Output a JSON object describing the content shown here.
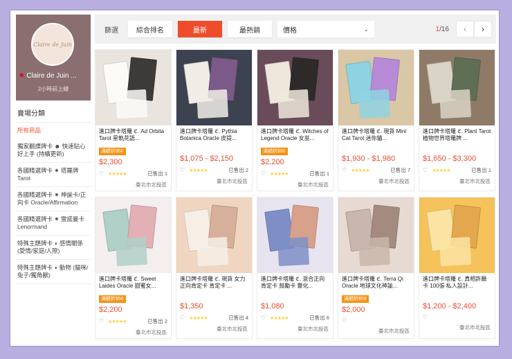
{
  "shop": {
    "logo_text": "Claire de Juin",
    "name": "Claire de Juin ...",
    "status": "2小時前上線"
  },
  "sidebar": {
    "title": "賣場分類",
    "items": [
      {
        "label": "所有商品",
        "active": true
      },
      {
        "label": "獨家翻譯牌卡 ☻ 快速贴心好上手 (持續更新)"
      },
      {
        "label": "各國精選牌卡 ✷ 塔羅牌 Tarot"
      },
      {
        "label": "各國精選牌卡 ✷ 神諭卡/正向卡 Oracle/Affirmation"
      },
      {
        "label": "各國精選牌卡 ✷ 雷諾曼卡 Lenormand"
      },
      {
        "label": "特殊主題牌卡 ◗ 感情關係 (愛情/家庭/人際)"
      },
      {
        "label": "特殊主題牌卡 ◗ 動物 (貓咪/兔子/獨角獸)"
      }
    ]
  },
  "filter": {
    "label": "篩選",
    "buttons": [
      "綜合排名",
      "最新",
      "最熱銷"
    ],
    "active": "最新",
    "price_select": "價格",
    "page_current": "1",
    "page_total": "/16",
    "prev": "‹",
    "next": "›"
  },
  "products": [
    {
      "name": "進口牌卡塔羅 ℭ. Ad Orbita Tarot 星軌花語...",
      "promo": "滿額折$50",
      "price": "$2,300",
      "rating": 5,
      "sold": "已售出 1",
      "location": "臺北市北投區"
    },
    {
      "name": "進口牌卡塔羅 ℭ. Pythia Botanica Oracle 皮提...",
      "promo": "",
      "price": "$1,075 - $2,150",
      "rating": 5,
      "sold": "已售出 2",
      "location": "臺北市北投區"
    },
    {
      "name": "進口牌卡塔羅 ℭ. Witches of Legend Oracle 女巫...",
      "promo": "滿額折$50",
      "price": "$2,200",
      "rating": 5,
      "sold": "已售出 1",
      "location": "臺北市北投區"
    },
    {
      "name": "進口牌卡塔羅 ℭ. 現貨 Mini Cat Tarot 迷你貓...",
      "promo": "",
      "price": "$1,930 - $1,980",
      "rating": 5,
      "sold": "已售出 7",
      "location": "臺北市北投區"
    },
    {
      "name": "進口牌卡塔羅 ℭ. Plant Tarot 植物世界塔羅牌 ...",
      "promo": "",
      "price": "$1,650 - $3,300",
      "rating": 5,
      "sold": "已售出 1",
      "location": "臺北市北投區"
    },
    {
      "name": "進口牌卡塔羅 ℭ. Sweet Laides Oracle 甜蜜女...",
      "promo": "滿額折$50",
      "price": "$2,200",
      "rating": 5,
      "sold": "已售出 2",
      "location": "臺北市北投區"
    },
    {
      "name": "進口牌卡塔羅 ℭ. 現貨 女力正向肯定卡 肯定卡 ...",
      "promo": "",
      "price": "$1,350",
      "rating": 5,
      "sold": "已售出 4",
      "location": "臺北市北投區"
    },
    {
      "name": "進口牌卡塔羅 ℭ. 混合正向肯定卡 鼓勵卡 靈化...",
      "promo": "",
      "price": "$1,080",
      "rating": 5,
      "sold": "已售出 6",
      "location": "臺北市北投區"
    },
    {
      "name": "進口牌卡塔羅 ℭ. Terra Qi Oracle 地球文化神諭...",
      "promo": "滿額折$50",
      "price": "$2,000",
      "rating": 0,
      "sold": "",
      "location": "臺北市北投區"
    },
    {
      "name": "進口牌卡塔羅 ℭ. 真相許願卡 100張 私人設計...",
      "promo": "",
      "price": "$1,200 - $2,400",
      "rating": 0,
      "sold": "",
      "location": "臺北市北投區"
    }
  ],
  "colors": {
    "accent": "#ee4d2d",
    "promo": "#f69113",
    "background": "#b9aee0"
  }
}
